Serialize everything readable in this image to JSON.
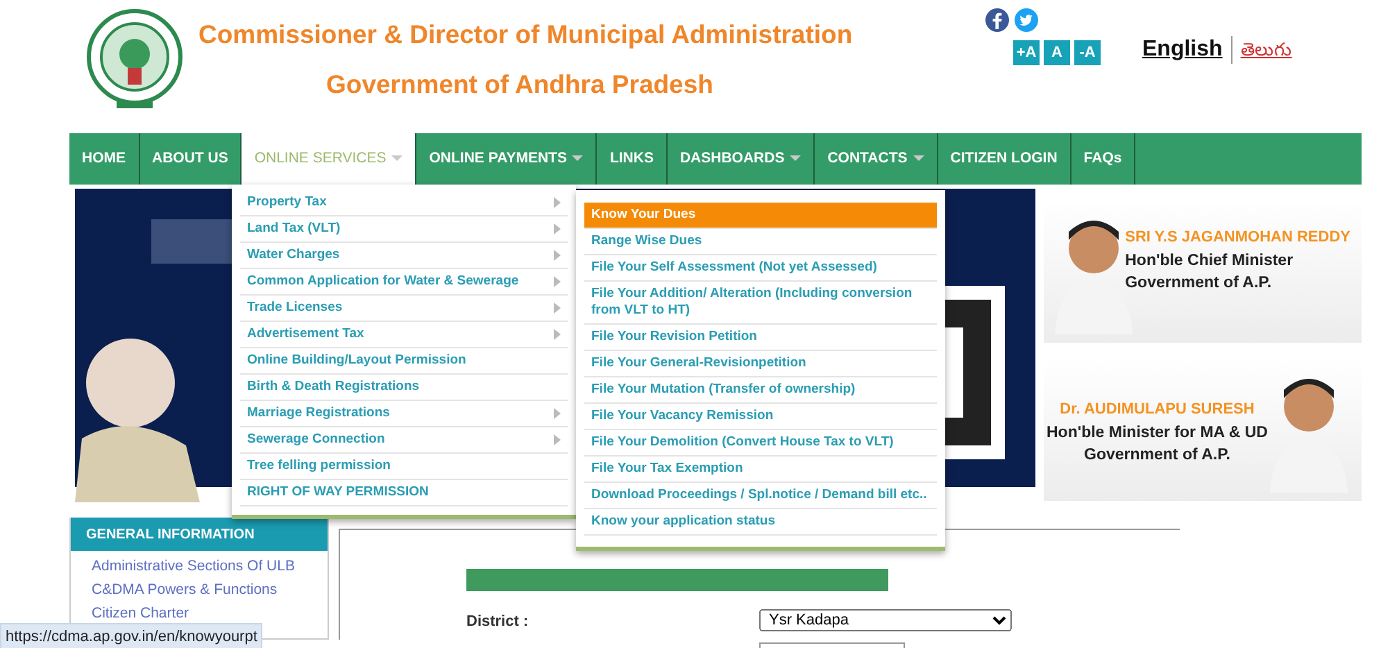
{
  "header": {
    "title": "Commissioner & Director of Municipal Administration",
    "subtitle": "Government of Andhra Pradesh",
    "font_buttons": [
      "+A",
      "A",
      "-A"
    ],
    "languages": [
      {
        "label": "English",
        "selected": true
      },
      {
        "label": "తెలుగు",
        "selected": false
      }
    ]
  },
  "nav": [
    {
      "label": "HOME",
      "has_dropdown": false,
      "selected": false
    },
    {
      "label": "ABOUT US",
      "has_dropdown": false,
      "selected": false
    },
    {
      "label": "ONLINE SERVICES",
      "has_dropdown": true,
      "selected": true
    },
    {
      "label": "ONLINE PAYMENTS",
      "has_dropdown": true,
      "selected": false
    },
    {
      "label": "LINKS",
      "has_dropdown": false,
      "selected": false
    },
    {
      "label": "DASHBOARDS",
      "has_dropdown": true,
      "selected": false
    },
    {
      "label": "CONTACTS",
      "has_dropdown": true,
      "selected": false
    },
    {
      "label": "CITIZEN LOGIN",
      "has_dropdown": false,
      "selected": false
    },
    {
      "label": "FAQs",
      "has_dropdown": false,
      "selected": false
    }
  ],
  "services_menu": [
    {
      "label": "Property Tax",
      "has_submenu": true
    },
    {
      "label": "Land Tax (VLT)",
      "has_submenu": true
    },
    {
      "label": "Water Charges",
      "has_submenu": true
    },
    {
      "label": "Common Application for Water & Sewerage",
      "has_submenu": true
    },
    {
      "label": "Trade Licenses",
      "has_submenu": true
    },
    {
      "label": "Advertisement Tax",
      "has_submenu": true
    },
    {
      "label": "Online Building/Layout Permission",
      "has_submenu": false
    },
    {
      "label": "Birth & Death Registrations",
      "has_submenu": false
    },
    {
      "label": "Marriage Registrations",
      "has_submenu": true
    },
    {
      "label": "Sewerage Connection",
      "has_submenu": true
    },
    {
      "label": "Tree felling permission",
      "has_submenu": false
    },
    {
      "label": "RIGHT OF WAY PERMISSION",
      "has_submenu": false
    }
  ],
  "property_tax_menu": [
    {
      "label": "Know Your Dues",
      "selected": true
    },
    {
      "label": "Range Wise Dues",
      "selected": false
    },
    {
      "label": "File Your Self Assessment (Not yet Assessed)",
      "selected": false
    },
    {
      "label": "File Your Addition/ Alteration (Including conversion from VLT to HT)",
      "selected": false
    },
    {
      "label": "File Your Revision Petition",
      "selected": false
    },
    {
      "label": "File Your General-Revisionpetition",
      "selected": false
    },
    {
      "label": "File Your Mutation (Transfer of ownership)",
      "selected": false
    },
    {
      "label": "File Your Vacancy Remission",
      "selected": false
    },
    {
      "label": "File Your Demolition (Convert House Tax to VLT)",
      "selected": false
    },
    {
      "label": "File Your Tax Exemption",
      "selected": false
    },
    {
      "label": "Download Proceedings / Spl.notice / Demand bill etc..",
      "selected": false
    },
    {
      "label": "Know your application status",
      "selected": false
    }
  ],
  "ministers": [
    {
      "name": "SRI Y.S JAGANMOHAN REDDY",
      "role": "Hon'ble Chief Minister",
      "org": "Government of A.P."
    },
    {
      "name": "Dr. AUDIMULAPU SURESH",
      "role": "Hon'ble Minister for MA & UD",
      "org": "Government of A.P."
    }
  ],
  "sidebar": {
    "title": "GENERAL INFORMATION",
    "links": [
      "Administrative Sections Of ULB",
      "C&DMA Powers & Functions",
      "Citizen Charter"
    ]
  },
  "form": {
    "district_label": "District :",
    "district_value": "Ysr Kadapa"
  },
  "status_url": "https://cdma.ap.gov.in/en/knowyourpt"
}
